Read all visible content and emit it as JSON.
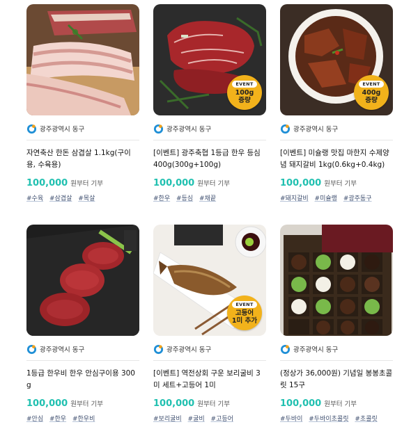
{
  "cards": [
    {
      "org": "광주광역시 동구",
      "title": "자연축산 한돈 삼겹살 1.1kg(구이용, 수육용)",
      "price": "100,000",
      "price_unit": "원부터 기부",
      "tags": [
        "#수육",
        "#삼겹살",
        "#목살"
      ],
      "image": "pork-belly"
    },
    {
      "org": "광주광역시 동구",
      "title": "[이벤트] 광주축협 1등급 한우 등심 400g(300g+100g)",
      "price": "100,000",
      "price_unit": "원부터 기부",
      "tags": [
        "#한우",
        "#등심",
        "#채끝"
      ],
      "image": "beef-sirloin",
      "badge": {
        "event": "EVENT",
        "line1": "100g",
        "line2": "증량"
      }
    },
    {
      "org": "광주광역시 동구",
      "title": "[이벤트] 미슐랭 맛집 마한지 수제양념 돼지갈비 1kg(0.6kg+0.4kg)",
      "price": "100,000",
      "price_unit": "원부터 기부",
      "tags": [
        "#돼지갈비",
        "#미슐랭",
        "#광주동구"
      ],
      "image": "marinated-ribs",
      "badge": {
        "event": "EVENT",
        "line1": "400g",
        "line2": "증량"
      }
    },
    {
      "org": "광주광역시 동구",
      "title": "1등급 한우비 한우 안심구이용 300g",
      "price": "100,000",
      "price_unit": "원부터 기부",
      "tags": [
        "#안심",
        "#한우",
        "#한우비"
      ],
      "image": "beef-tenderloin"
    },
    {
      "org": "광주광역시 동구",
      "title": "[이벤트] 역전상회 구운 보리굴비 3미 세트+고등어 1미",
      "price": "100,000",
      "price_unit": "원부터 기부",
      "tags": [
        "#보리굴비",
        "#굴비",
        "#고등어"
      ],
      "image": "grilled-croaker",
      "badge": {
        "event": "EVENT",
        "line1": "고등어",
        "line2": "1미 추가"
      }
    },
    {
      "org": "광주광역시 동구",
      "title": "(정상가 36,000원) 기념일 봉봉초콜릿 15구",
      "price": "100,000",
      "price_unit": "원부터 기부",
      "tags": [
        "#두바이",
        "#두바이초콜릿",
        "#초콜릿"
      ],
      "image": "chocolate-box"
    }
  ],
  "colors": {
    "price": "#20c0b0",
    "badge": "#f2b21b"
  }
}
